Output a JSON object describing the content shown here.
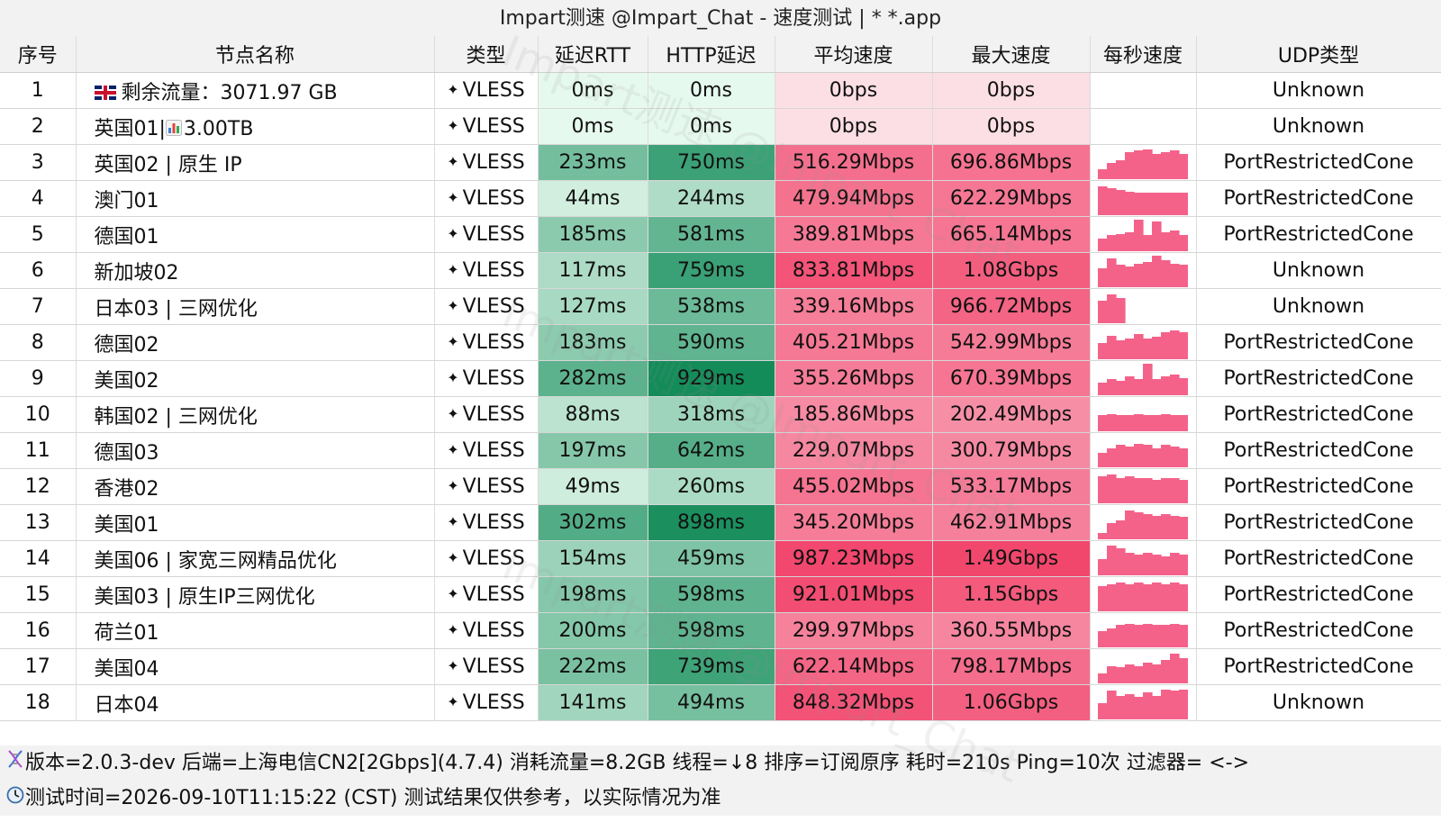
{
  "window_title": "Impart测速 @Impart_Chat - 速度测试 | * *.app",
  "headers": [
    "序号",
    "节点名称",
    "类型",
    "延迟RTT",
    "HTTP延迟",
    "平均速度",
    "最大速度",
    "每秒速度",
    "UDP类型"
  ],
  "rows": [
    {
      "id": "1",
      "name": "剩余流量：3071.97 GB",
      "flag": "uk-flag",
      "type": "VLESS",
      "rtt": "0ms",
      "http": "0ms",
      "avg": "0bps",
      "max": "0bps",
      "udp": "Unknown",
      "rtt_v": 0,
      "http_v": 0,
      "avg_v": 0,
      "max_v": 0,
      "spark": []
    },
    {
      "id": "2",
      "name": "英国01|",
      "suffix": "3.00TB",
      "bar_icon": true,
      "type": "VLESS",
      "rtt": "0ms",
      "http": "0ms",
      "avg": "0bps",
      "max": "0bps",
      "udp": "Unknown",
      "rtt_v": 0,
      "http_v": 0,
      "avg_v": 0,
      "max_v": 0,
      "spark": []
    },
    {
      "id": "3",
      "name": "英国02 | 原生 IP",
      "type": "VLESS",
      "rtt": "233ms",
      "http": "750ms",
      "avg": "516.29Mbps",
      "max": "696.86Mbps",
      "udp": "PortRestrictedCone",
      "rtt_v": 233,
      "http_v": 750,
      "avg_v": 516.29,
      "max_v": 696.86,
      "spark": [
        0.3,
        0.5,
        0.6,
        0.85,
        0.9,
        0.95,
        0.8,
        0.85,
        0.9,
        0.8
      ]
    },
    {
      "id": "4",
      "name": "澳门01",
      "type": "VLESS",
      "rtt": "44ms",
      "http": "244ms",
      "avg": "479.94Mbps",
      "max": "622.29Mbps",
      "udp": "PortRestrictedCone",
      "rtt_v": 44,
      "http_v": 244,
      "avg_v": 479.94,
      "max_v": 622.29,
      "spark": [
        0.9,
        0.85,
        0.8,
        0.75,
        0.7,
        0.7,
        0.7,
        0.7,
        0.7,
        0.7
      ]
    },
    {
      "id": "5",
      "name": "德国01",
      "type": "VLESS",
      "rtt": "185ms",
      "http": "581ms",
      "avg": "389.81Mbps",
      "max": "665.14Mbps",
      "udp": "PortRestrictedCone",
      "rtt_v": 185,
      "http_v": 581,
      "avg_v": 389.81,
      "max_v": 665.14,
      "spark": [
        0.4,
        0.5,
        0.55,
        0.6,
        1.0,
        0.5,
        0.95,
        0.6,
        0.65,
        0.5
      ]
    },
    {
      "id": "6",
      "name": "新加坡02",
      "type": "VLESS",
      "rtt": "117ms",
      "http": "759ms",
      "avg": "833.81Mbps",
      "max": "1.08Gbps",
      "udp": "Unknown",
      "rtt_v": 117,
      "http_v": 759,
      "avg_v": 833.81,
      "max_v": 1080,
      "spark": [
        0.6,
        0.9,
        0.7,
        0.65,
        0.75,
        0.8,
        1.0,
        0.85,
        0.75,
        0.7
      ]
    },
    {
      "id": "7",
      "name": "日本03 | 三网优化",
      "type": "VLESS",
      "rtt": "127ms",
      "http": "538ms",
      "avg": "339.16Mbps",
      "max": "966.72Mbps",
      "udp": "Unknown",
      "rtt_v": 127,
      "http_v": 538,
      "avg_v": 339.16,
      "max_v": 966.72,
      "spark": [
        0.7,
        0.9,
        0.8,
        0.0,
        0.0,
        0.0,
        0.0,
        0.0,
        0.0,
        0.0
      ]
    },
    {
      "id": "8",
      "name": "德国02",
      "type": "VLESS",
      "rtt": "183ms",
      "http": "590ms",
      "avg": "405.21Mbps",
      "max": "542.99Mbps",
      "udp": "PortRestrictedCone",
      "rtt_v": 183,
      "http_v": 590,
      "avg_v": 405.21,
      "max_v": 542.99,
      "spark": [
        0.5,
        0.75,
        0.6,
        0.65,
        0.8,
        0.65,
        0.7,
        0.85,
        0.9,
        0.85
      ]
    },
    {
      "id": "9",
      "name": "美国02",
      "type": "VLESS",
      "rtt": "282ms",
      "http": "929ms",
      "avg": "355.26Mbps",
      "max": "670.39Mbps",
      "udp": "PortRestrictedCone",
      "rtt_v": 282,
      "http_v": 929,
      "avg_v": 355.26,
      "max_v": 670.39,
      "spark": [
        0.4,
        0.5,
        0.45,
        0.6,
        0.5,
        1.0,
        0.5,
        0.6,
        0.65,
        0.55
      ]
    },
    {
      "id": "10",
      "name": "韩国02 | 三网优化",
      "type": "VLESS",
      "rtt": "88ms",
      "http": "318ms",
      "avg": "185.86Mbps",
      "max": "202.49Mbps",
      "udp": "PortRestrictedCone",
      "rtt_v": 88,
      "http_v": 318,
      "avg_v": 185.86,
      "max_v": 202.49,
      "spark": [
        0.5,
        0.55,
        0.5,
        0.5,
        0.55,
        0.5,
        0.5,
        0.55,
        0.5,
        0.5
      ]
    },
    {
      "id": "11",
      "name": "德国03",
      "type": "VLESS",
      "rtt": "197ms",
      "http": "642ms",
      "avg": "229.07Mbps",
      "max": "300.79Mbps",
      "udp": "PortRestrictedCone",
      "rtt_v": 197,
      "http_v": 642,
      "avg_v": 229.07,
      "max_v": 300.79,
      "spark": [
        0.45,
        0.6,
        0.7,
        0.65,
        0.75,
        0.7,
        0.6,
        0.7,
        0.65,
        0.6
      ]
    },
    {
      "id": "12",
      "name": "香港02",
      "type": "VLESS",
      "rtt": "49ms",
      "http": "260ms",
      "avg": "455.02Mbps",
      "max": "533.17Mbps",
      "udp": "PortRestrictedCone",
      "rtt_v": 49,
      "http_v": 260,
      "avg_v": 455.02,
      "max_v": 533.17,
      "spark": [
        0.85,
        0.9,
        0.8,
        0.85,
        0.8,
        0.8,
        0.75,
        0.8,
        0.8,
        0.75
      ]
    },
    {
      "id": "13",
      "name": "美国01",
      "type": "VLESS",
      "rtt": "302ms",
      "http": "898ms",
      "avg": "345.20Mbps",
      "max": "462.91Mbps",
      "udp": "PortRestrictedCone",
      "rtt_v": 302,
      "http_v": 898,
      "avg_v": 345.2,
      "max_v": 462.91,
      "spark": [
        0.2,
        0.5,
        0.6,
        0.9,
        0.85,
        0.8,
        0.75,
        0.8,
        0.75,
        0.7
      ]
    },
    {
      "id": "14",
      "name": "美国06 | 家宽三网精品优化",
      "type": "VLESS",
      "rtt": "154ms",
      "http": "459ms",
      "avg": "987.23Mbps",
      "max": "1.49Gbps",
      "udp": "PortRestrictedCone",
      "rtt_v": 154,
      "http_v": 459,
      "avg_v": 987.23,
      "max_v": 1490,
      "spark": [
        0.5,
        0.95,
        0.85,
        0.7,
        0.65,
        0.7,
        0.65,
        0.6,
        0.7,
        0.65
      ]
    },
    {
      "id": "15",
      "name": "美国03 | 原生IP三网优化",
      "type": "VLESS",
      "rtt": "198ms",
      "http": "598ms",
      "avg": "921.01Mbps",
      "max": "1.15Gbps",
      "udp": "PortRestrictedCone",
      "rtt_v": 198,
      "http_v": 598,
      "avg_v": 921.01,
      "max_v": 1150,
      "spark": [
        0.8,
        0.85,
        0.9,
        0.85,
        0.9,
        0.85,
        0.9,
        0.85,
        0.9,
        0.85
      ]
    },
    {
      "id": "16",
      "name": "荷兰01",
      "type": "VLESS",
      "rtt": "200ms",
      "http": "598ms",
      "avg": "299.97Mbps",
      "max": "360.55Mbps",
      "udp": "PortRestrictedCone",
      "rtt_v": 200,
      "http_v": 598,
      "avg_v": 299.97,
      "max_v": 360.55,
      "spark": [
        0.5,
        0.6,
        0.7,
        0.75,
        0.7,
        0.75,
        0.7,
        0.7,
        0.75,
        0.7
      ]
    },
    {
      "id": "17",
      "name": "美国04",
      "type": "VLESS",
      "rtt": "222ms",
      "http": "739ms",
      "avg": "622.14Mbps",
      "max": "798.17Mbps",
      "udp": "PortRestrictedCone",
      "rtt_v": 222,
      "http_v": 739,
      "avg_v": 622.14,
      "max_v": 798.17,
      "spark": [
        0.3,
        0.55,
        0.5,
        0.6,
        0.55,
        0.65,
        0.6,
        0.75,
        0.95,
        0.8
      ]
    },
    {
      "id": "18",
      "name": "日本04",
      "type": "VLESS",
      "rtt": "141ms",
      "http": "494ms",
      "avg": "848.32Mbps",
      "max": "1.06Gbps",
      "udp": "Unknown",
      "rtt_v": 141,
      "http_v": 494,
      "avg_v": 848.32,
      "max_v": 1060,
      "spark": [
        0.5,
        0.9,
        0.75,
        0.8,
        0.7,
        0.85,
        0.75,
        0.95,
        0.9,
        0.95
      ]
    }
  ],
  "footer": {
    "line1": "版本=2.0.3-dev  后端=上海电信CN2[2Gbps](4.7.4) 消耗流量=8.2GB  线程=↓8  排序=订阅原序  耗时=210s  Ping=10次  过滤器= <->",
    "line1_icon": "dna-icon",
    "line2": "测试时间=2026-09-10T11:15:22 (CST)  测试结果仅供参考，以实际情况为准",
    "line2_icon": "clock-icon"
  },
  "colors": {
    "header_bg": "#f2f2f2",
    "latency_green_light": "#e6f9ee",
    "latency_green_dark": "#0f8a56",
    "speed_pink_light": "#fbdfe5",
    "speed_pink_dark": "#f2466d",
    "spark_pink": "#f4628a",
    "flag_red": "#c8102e",
    "flag_blue": "#012169"
  },
  "watermark_text": "Impart测速 @Impart_Chat"
}
